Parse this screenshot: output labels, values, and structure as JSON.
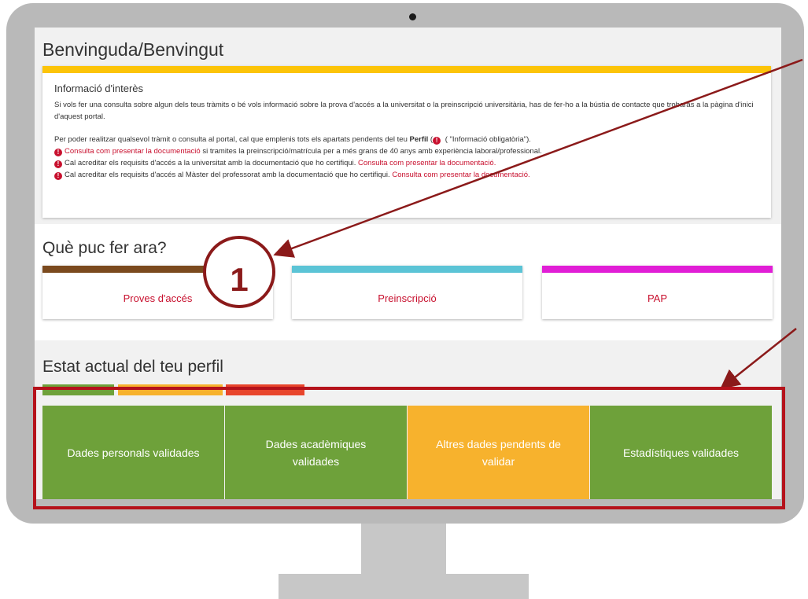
{
  "page": {
    "title": "Benvinguda/Benvingut"
  },
  "info": {
    "heading": "Informació d'interès",
    "para1": "Si vols fer una consulta sobre algun dels teus tràmits o bé vols informació sobre la prova d'accés a la universitat o la preinscripció universitària, has de fer-ho a la bústia de contacte que trobaràs a la pàgina d'inici d'aquest portal.",
    "para2_start": "Per poder realitzar qualsevol tràmit o consulta al portal, cal que emplenis tots els apartats pendents del teu ",
    "para2_bold": "Perfil",
    "para2_end": " (  \"Informació obligatòria\").",
    "line1_link": "Consulta com presentar la documentació",
    "line1_text": " si tramites la preinscripció/matrícula per a més grans de 40 anys amb experiència laboral/professional.",
    "line2_text": "Cal acreditar els requisits d'accés a la universitat amb la documentació que ho certifiqui. ",
    "line2_link": "Consulta com presentar la documentació.",
    "line3_text": "Cal acreditar els requisits d'accés al Màster del professorat amb la documentació que ho certifiqui. ",
    "line3_link": "Consulta com presentar la documentació.",
    "icon": "exclamation-circle-icon",
    "icon_glyph": "!"
  },
  "actions": {
    "title": "Què puc fer ara?",
    "cards": [
      {
        "label": "Proves d'accés",
        "color": "#7b4a1e"
      },
      {
        "label": "Preinscripció",
        "color": "#5bc4d6"
      },
      {
        "label": "PAP",
        "color": "#e11ed6"
      }
    ]
  },
  "profile": {
    "title": "Estat actual del teu perfil",
    "legend_colors": [
      "#6ea13a",
      "#f7b22d",
      "#e8452c"
    ],
    "tiles": [
      {
        "label": "Dades personals validades",
        "status": "validated",
        "color": "#6ea13a"
      },
      {
        "label": "Dades acadèmiques validades",
        "status": "validated",
        "color": "#6ea13a"
      },
      {
        "label": "Altres dades pendents de validar",
        "status": "pending",
        "color": "#f7b22d"
      },
      {
        "label": "Estadístiques validades",
        "status": "validated",
        "color": "#6ea13a"
      }
    ]
  },
  "annotation": {
    "number": "1",
    "color": "#8b1a1a"
  }
}
